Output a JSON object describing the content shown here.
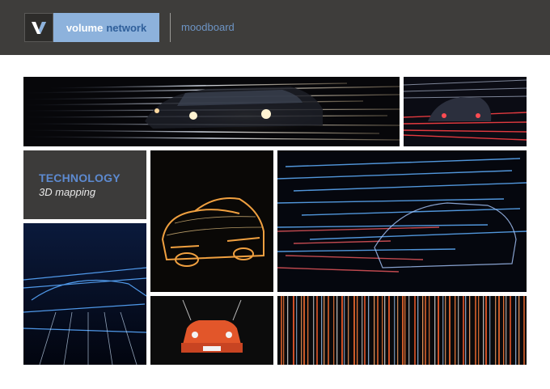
{
  "header": {
    "brand_word1": "volume",
    "brand_word2": "network",
    "section_label": "moodboard",
    "logo_letter": "V"
  },
  "caption": {
    "title": "TECHNOLOGY",
    "subtitle": "3D mapping"
  },
  "colors": {
    "header_bg": "#3e3d3b",
    "brand_bg": "#8db2dc",
    "accent_blue": "#5d8ad0",
    "caption_bg": "#3c3b3a"
  },
  "tiles": [
    {
      "name": "car-light-trails-wide-photo"
    },
    {
      "name": "red-car-light-trails-photo"
    },
    {
      "name": "fire-light-painting-car-photo"
    },
    {
      "name": "blue-red-particle-car-photo"
    },
    {
      "name": "blue-wireframe-car-photo"
    },
    {
      "name": "orange-bmw-car-photo"
    },
    {
      "name": "vertical-orange-lines-photo"
    }
  ]
}
